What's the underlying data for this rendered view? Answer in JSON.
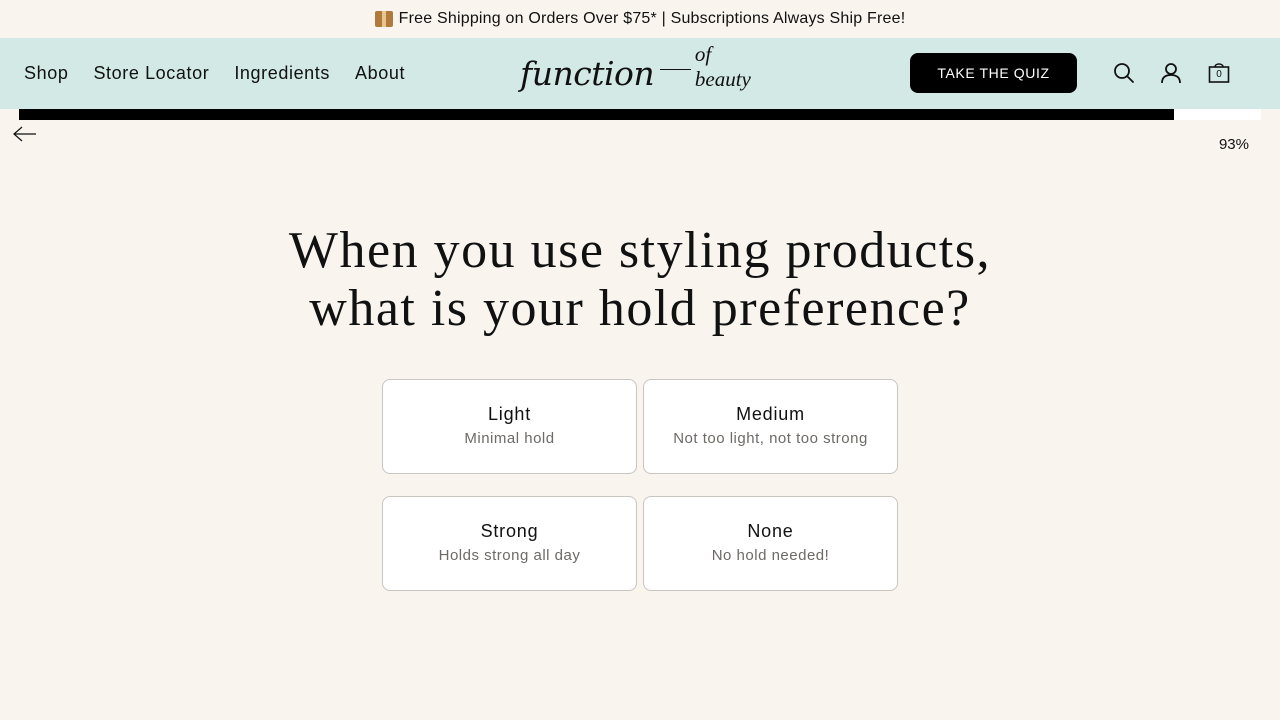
{
  "announcement": {
    "icon": "package-icon",
    "text": "Free Shipping on Orders Over $75* | Subscriptions Always Ship Free!"
  },
  "nav": {
    "items": [
      {
        "label": "Shop"
      },
      {
        "label": "Store Locator"
      },
      {
        "label": "Ingredients"
      },
      {
        "label": "About"
      }
    ]
  },
  "logo": {
    "main": "function",
    "sub": "of beauty"
  },
  "header": {
    "quiz_button": "TAKE THE QUIZ",
    "bag_count": "0",
    "icons": [
      "search-icon",
      "account-icon",
      "shopping-bag-icon"
    ]
  },
  "progress": {
    "value": 0.93,
    "label": "93%"
  },
  "quiz": {
    "question": "When you use styling products, what is your hold preference?",
    "options": [
      {
        "title": "Light",
        "description": "Minimal hold"
      },
      {
        "title": "Medium",
        "description": "Not too light, not too strong"
      },
      {
        "title": "Strong",
        "description": "Holds strong all day"
      },
      {
        "title": "None",
        "description": "No hold needed!"
      }
    ]
  },
  "colors": {
    "background": "#f9f4ee",
    "header": "#d3e9e5",
    "accent": "#000000"
  }
}
